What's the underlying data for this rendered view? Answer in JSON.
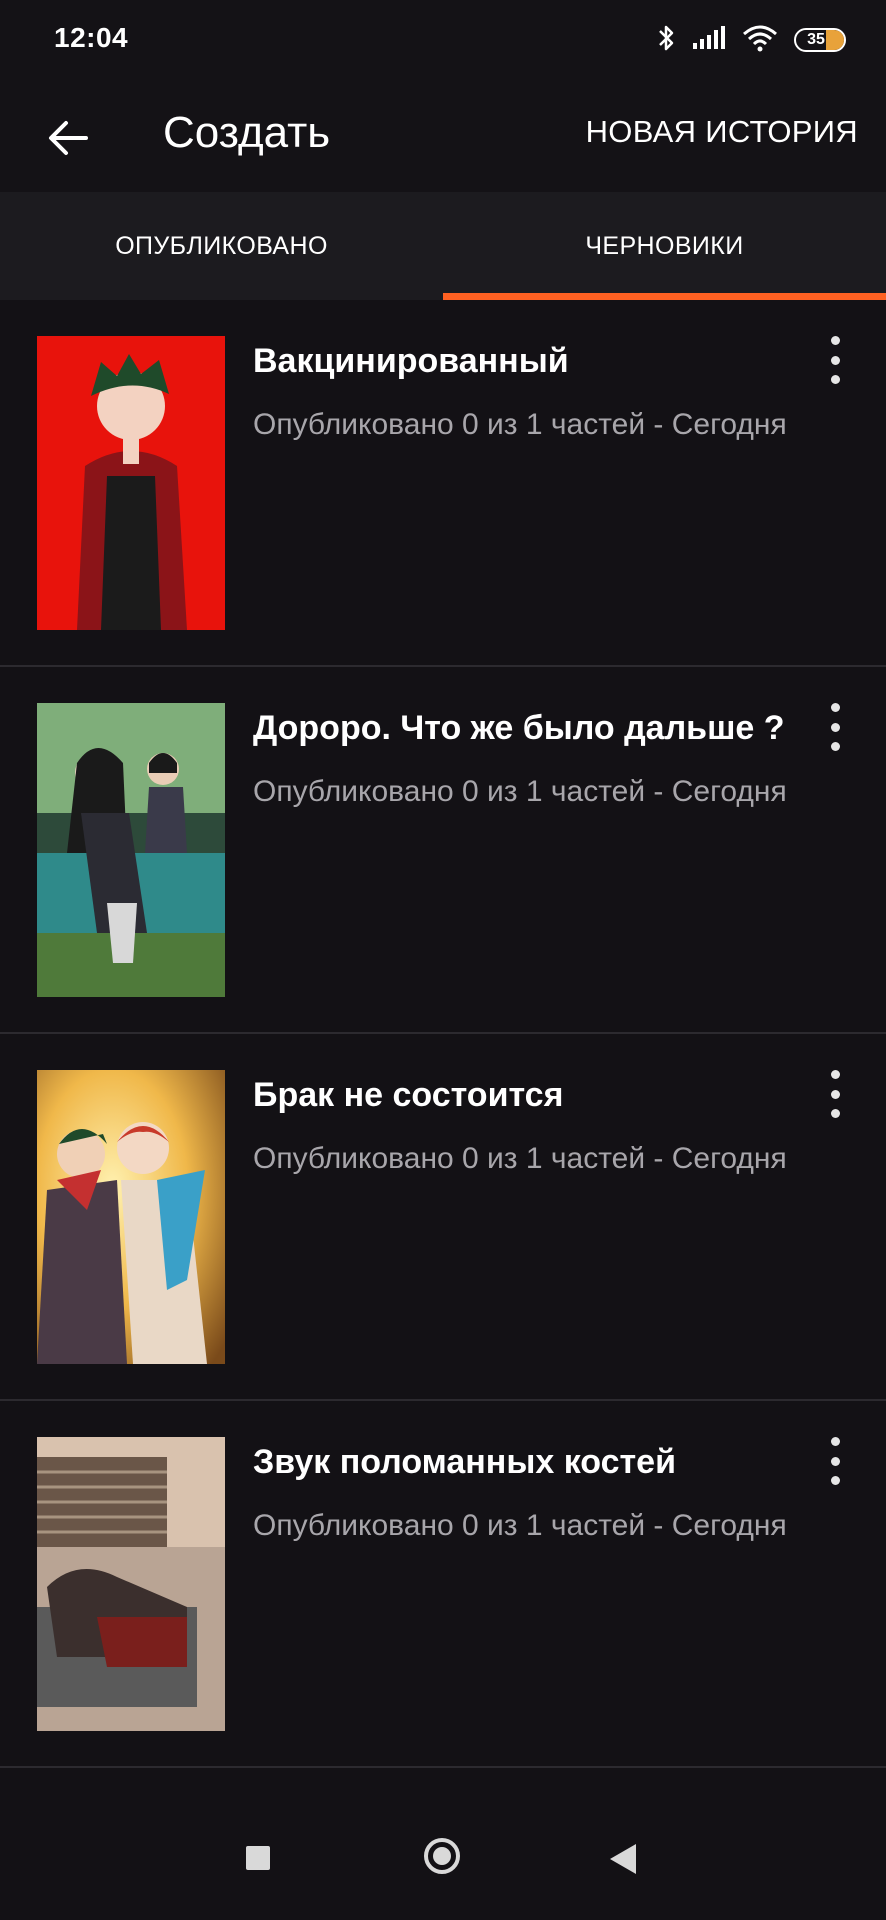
{
  "status_bar": {
    "time": "12:04",
    "battery": "35",
    "icons": [
      "bluetooth-icon",
      "signal-icon",
      "wifi-icon",
      "battery-icon"
    ]
  },
  "app_bar": {
    "title": "Создать",
    "action": "НОВАЯ ИСТОРИЯ",
    "back_icon": "arrow-left-icon"
  },
  "tabs": {
    "items": [
      {
        "label": "ОПУБЛИКОВАНО",
        "active": false
      },
      {
        "label": "ЧЕРНОВИКИ",
        "active": true
      }
    ],
    "accent": "#ff6122"
  },
  "stories": [
    {
      "title": "Вакцинированный",
      "meta": "Опубликовано 0 из 1 частей - Сегодня",
      "cover_colors": [
        "#e8130c",
        "#1b1b1b",
        "#b0232b"
      ]
    },
    {
      "title": "Дороро. Что же было дальше ?",
      "meta": "Опубликовано 0 из 1 частей - Сегодня",
      "cover_colors": [
        "#4f8a5a",
        "#2d4a3a",
        "#9bc38a"
      ]
    },
    {
      "title": "Брак не состоится",
      "meta": "Опубликовано 0 из 1 частей - Сегодня",
      "cover_colors": [
        "#f3c65a",
        "#4a3a3a",
        "#3aa0c8"
      ]
    },
    {
      "title": "Звук поломанных костей",
      "meta": "Опубликовано 0 из 1 частей - Сегодня",
      "cover_colors": [
        "#d9c2ae",
        "#3b2f2d",
        "#7a1f1c"
      ]
    }
  ],
  "nav_bar": {
    "icons": [
      "recents-square-icon",
      "home-circle-icon",
      "back-triangle-icon"
    ]
  }
}
